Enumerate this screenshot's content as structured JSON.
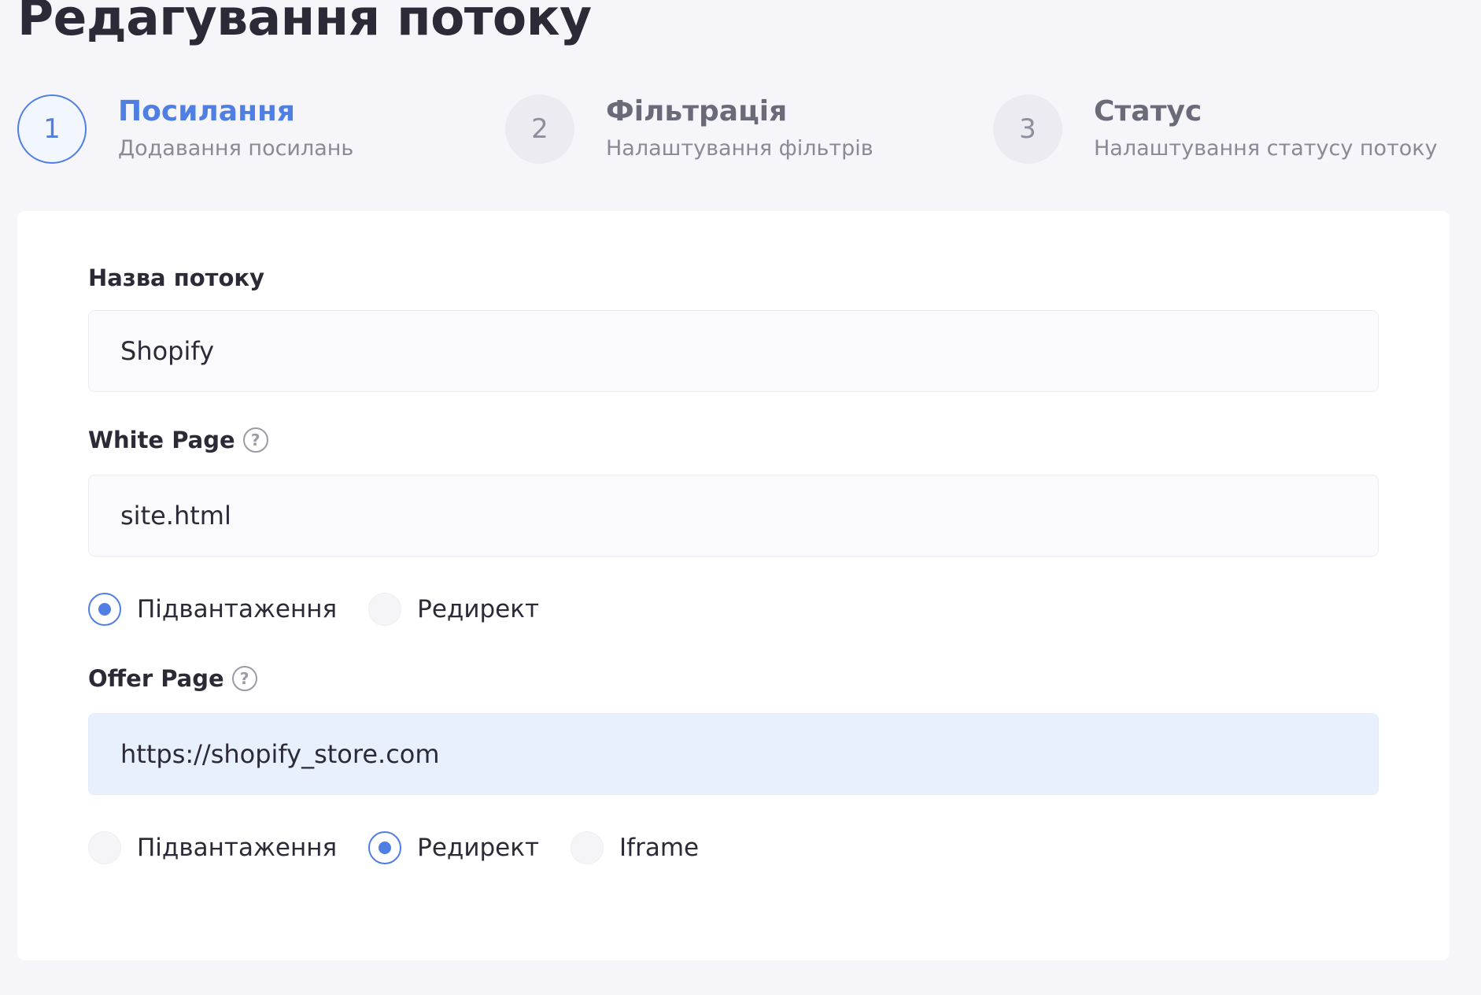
{
  "page_title": "Редагування потоку",
  "steps": [
    {
      "number": "1",
      "title": "Посилання",
      "subtitle": "Додавання посилань",
      "active": true
    },
    {
      "number": "2",
      "title": "Фільтрація",
      "subtitle": "Налаштування фільтрів",
      "active": false
    },
    {
      "number": "3",
      "title": "Статус",
      "subtitle": "Налаштування статусу потоку",
      "active": false
    }
  ],
  "form": {
    "stream_name": {
      "label": "Назва потоку",
      "value": "Shopify"
    },
    "white_page": {
      "label": "White Page",
      "help_icon": "question-circle",
      "value": "site.html",
      "options": [
        "Підвантаження",
        "Редирект"
      ],
      "selected": "Підвантаження"
    },
    "offer_page": {
      "label": "Offer Page",
      "help_icon": "question-circle",
      "value": "https://shopify_store.com",
      "options": [
        "Підвантаження",
        "Редирект",
        "Iframe"
      ],
      "selected": "Редирект"
    }
  },
  "colors": {
    "accent": "#4f7fe2",
    "background": "#f5f5fa",
    "card": "#ffffff",
    "input_filled": "#e9f0fd"
  }
}
